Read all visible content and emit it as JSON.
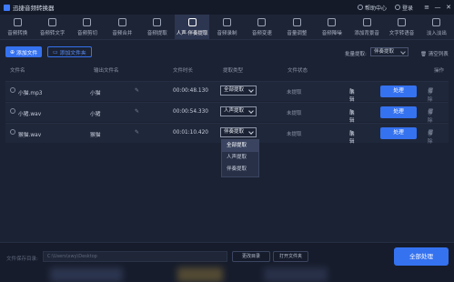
{
  "titlebar": {
    "app_title": "迅捷音频转换器",
    "help": "帮助中心",
    "login": "登录",
    "menu_glyph": "≡",
    "minimize_glyph": "—",
    "close_glyph": "✕"
  },
  "toolbar": {
    "tools": [
      {
        "label": "音频转换",
        "icon": "convert-icon"
      },
      {
        "label": "音频转文字",
        "icon": "text-icon"
      },
      {
        "label": "音频剪切",
        "icon": "scissors-icon"
      },
      {
        "label": "音频合并",
        "icon": "merge-icon"
      },
      {
        "label": "音频提取",
        "icon": "extract-icon"
      },
      {
        "label": "人声·伴奏提取",
        "icon": "vocal-icon",
        "active": true
      },
      {
        "label": "音频录制",
        "icon": "mic-icon"
      },
      {
        "label": "音频变速",
        "icon": "speed-icon"
      },
      {
        "label": "音量调整",
        "icon": "volume-icon"
      },
      {
        "label": "音频降噪",
        "icon": "denoise-icon"
      },
      {
        "label": "添加背景音",
        "icon": "music-icon"
      },
      {
        "label": "文字转语音",
        "icon": "tts-icon"
      },
      {
        "label": "淡入淡出",
        "icon": "fade-icon"
      }
    ]
  },
  "actions": {
    "add_file": "添加文件",
    "add_folder": "添加文件夹",
    "bulk_label": "批量提取:",
    "bulk_value": "伴奏提取",
    "clear_list": "清空列表",
    "plus_glyph": "⊕",
    "trash_glyph": "🗑"
  },
  "table": {
    "headers": {
      "file_name": "文件名",
      "output_name": "输出文件名",
      "duration": "文件时长",
      "type": "提取类型",
      "status": "文件状态",
      "ops": "操作"
    },
    "rows": [
      {
        "file": "小猫.mp3",
        "output": "小猫",
        "duration": "00:00:48.130",
        "type": "全部提取",
        "status": "未提取",
        "edit": "编辑",
        "process": "处理",
        "remove": "移除"
      },
      {
        "file": "小猪.wav",
        "output": "小猪",
        "duration": "00:00:54.330",
        "type": "人声提取",
        "status": "未提取",
        "edit": "编辑",
        "process": "处理",
        "remove": "移除"
      },
      {
        "file": "猴猫.wav",
        "output": "猴猫",
        "duration": "00:01:10.420",
        "type": "伴奏提取",
        "status": "未提取",
        "edit": "编辑",
        "process": "处理",
        "remove": "移除"
      }
    ]
  },
  "dropdown": {
    "options": [
      "全部提取",
      "人声提取",
      "伴奏提取"
    ],
    "selected": "全部提取"
  },
  "footer": {
    "save_label": "文件保存目录:",
    "path": "C:\\Users\\xwy\\Desktop",
    "change_dir": "更改目录",
    "open_folder": "打开文件夹",
    "process_all": "全部处理"
  }
}
